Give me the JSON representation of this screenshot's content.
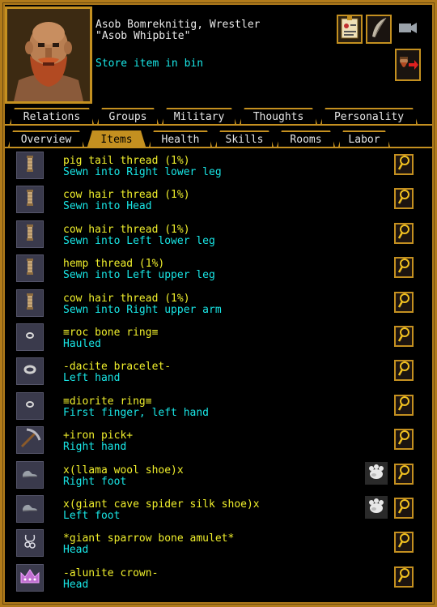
{
  "unit": {
    "name_line": "Asob Bomreknitig, Wrestler",
    "nickname": "\"Asob Whipbite\"",
    "action": "Store item in bin"
  },
  "header_buttons": [
    "job-icon",
    "quill-icon",
    "camera-icon",
    "follow-icon"
  ],
  "tabs_top": [
    {
      "label": "Relations"
    },
    {
      "label": "Groups"
    },
    {
      "label": "Military"
    },
    {
      "label": "Thoughts"
    },
    {
      "label": "Personality"
    }
  ],
  "tabs_bottom": [
    {
      "label": "Overview"
    },
    {
      "label": "Items",
      "active": true
    },
    {
      "label": "Health"
    },
    {
      "label": "Skills"
    },
    {
      "label": "Rooms"
    },
    {
      "label": "Labor"
    }
  ],
  "items": [
    {
      "name": "pig tail thread (1%)",
      "location": "Sewn into Right lower leg",
      "icon": "thread-icon"
    },
    {
      "name": "cow hair thread (1%)",
      "location": "Sewn into Head",
      "icon": "thread-icon"
    },
    {
      "name": "cow hair thread (1%)",
      "location": "Sewn into Left lower leg",
      "icon": "thread-icon"
    },
    {
      "name": "hemp thread (1%)",
      "location": "Sewn into Left upper leg",
      "icon": "thread-icon"
    },
    {
      "name": "cow hair thread (1%)",
      "location": "Sewn into Right upper arm",
      "icon": "thread-icon"
    },
    {
      "name": "≡roc bone ring≡",
      "location": "Hauled",
      "icon": "ring-icon"
    },
    {
      "name": "-dacite bracelet-",
      "location": "Left hand",
      "icon": "bracelet-icon"
    },
    {
      "name": "≡diorite ring≡",
      "location": "First finger, left hand",
      "icon": "ring-icon"
    },
    {
      "name": "+iron pick+",
      "location": "Right hand",
      "icon": "pick-icon"
    },
    {
      "name": "x(llama wool shoe)x",
      "location": "Right foot",
      "icon": "shoe-icon",
      "pet": true
    },
    {
      "name": "x(giant cave spider silk shoe)x",
      "location": "Left foot",
      "icon": "shoe-icon",
      "pet": true
    },
    {
      "name": "*giant sparrow bone amulet*",
      "location": "Head",
      "icon": "amulet-icon"
    },
    {
      "name": "-alunite crown-",
      "location": "Head",
      "icon": "crown-icon"
    }
  ],
  "colors": {
    "frame": "#c49020",
    "item_name": "#f0ef2c",
    "item_location": "#19e6e6"
  }
}
